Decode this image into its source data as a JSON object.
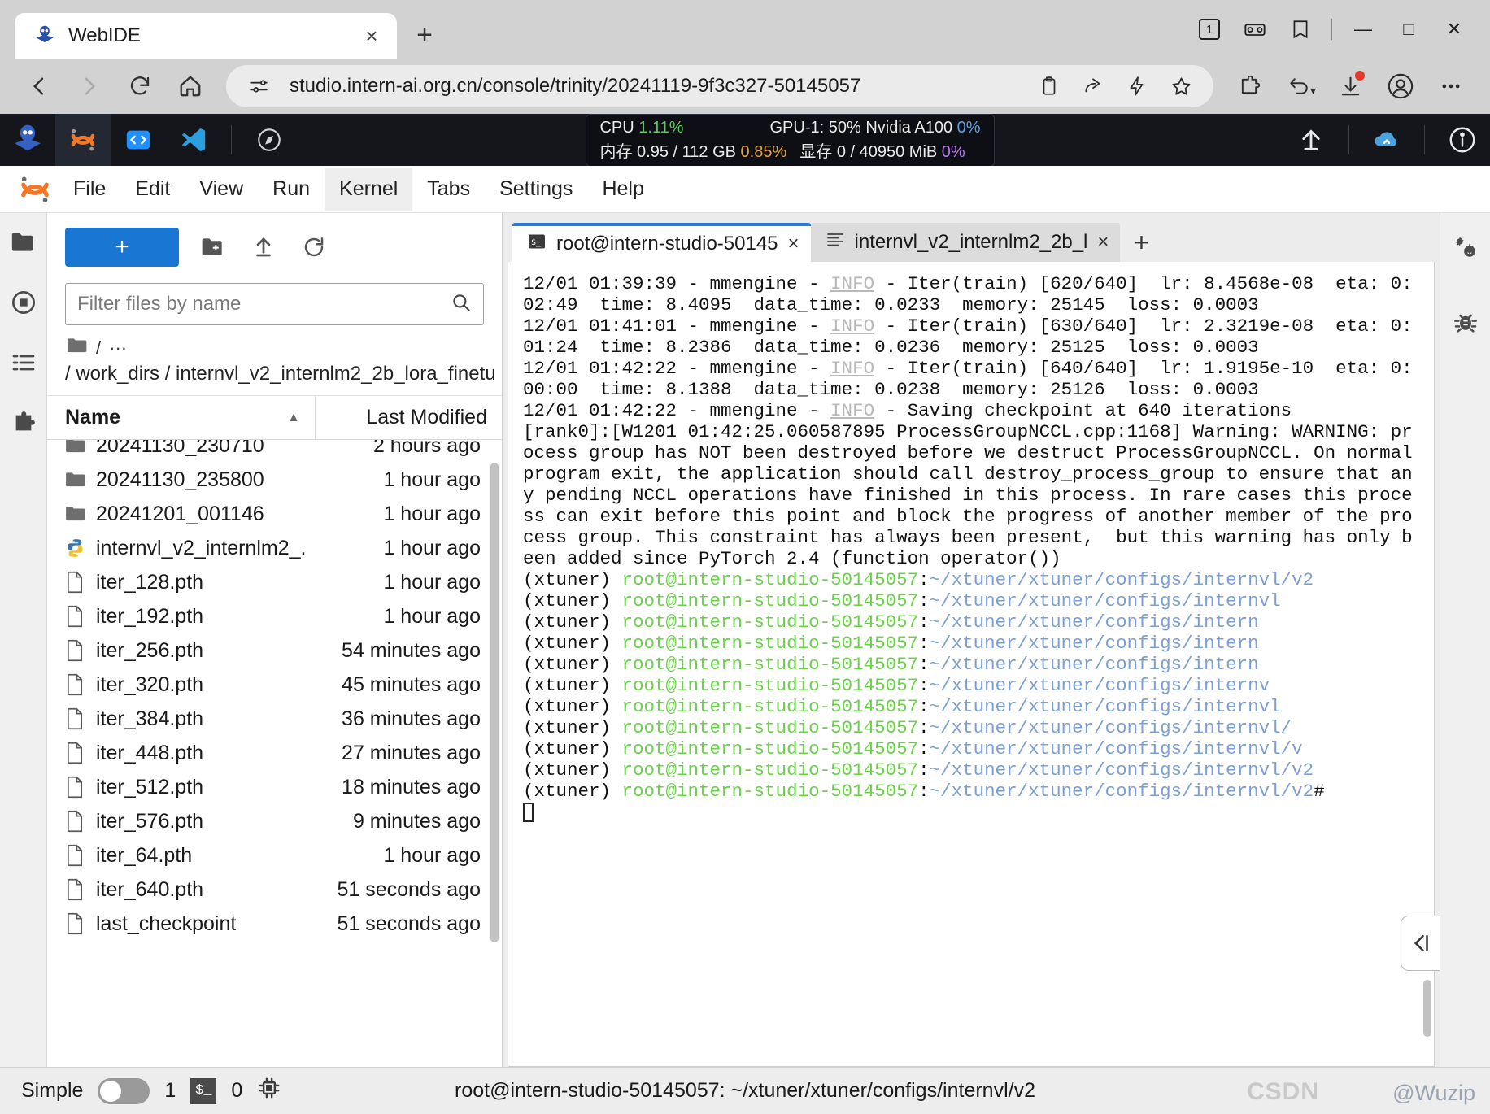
{
  "browser": {
    "tab": {
      "title": "WebIDE",
      "favicon": "intern-logo-icon",
      "close": "×"
    },
    "newtab_label": "+",
    "window_controls": {
      "count": "1",
      "minimize": "—",
      "maximize": "□",
      "close": "✕"
    },
    "nav": {
      "back": "‹",
      "forward": "›",
      "reload": "↻",
      "home": "⌂"
    },
    "omnibox": {
      "url": "studio.intern-ai.org.cn/console/trinity/20241119-9f3c327-50145057",
      "site_icon": "site-settings-icon"
    }
  },
  "topbar": {
    "stats": {
      "cpu_label": "CPU",
      "cpu_value": "1.11%",
      "gpu_label": "GPU-1: 50% Nvidia A100",
      "gpu_value": "0%",
      "mem_label": "内存",
      "mem_value": "0.95 / 112 GB",
      "mem_pct": "0.85%",
      "vram_label": "显存",
      "vram_value": "0 / 40950 MiB",
      "vram_pct": "0%"
    }
  },
  "menubar": {
    "items": [
      {
        "label": "File",
        "active": false
      },
      {
        "label": "Edit",
        "active": false
      },
      {
        "label": "View",
        "active": false
      },
      {
        "label": "Run",
        "active": false
      },
      {
        "label": "Kernel",
        "active": true
      },
      {
        "label": "Tabs",
        "active": false
      },
      {
        "label": "Settings",
        "active": false
      },
      {
        "label": "Help",
        "active": false
      }
    ]
  },
  "filebrowser": {
    "new_button": "+",
    "filter_placeholder": "Filter files by name",
    "breadcrumb_root": "/",
    "breadcrumb_ellipsis": "···",
    "path": "/ work_dirs / internvl_v2_internlm2_2b_lora_finetu",
    "columns": {
      "name": "Name",
      "modified": "Last Modified"
    },
    "rows": [
      {
        "icon": "folder-icon",
        "name": "20241130_230710",
        "modified": "2 hours ago"
      },
      {
        "icon": "folder-icon",
        "name": "20241130_235800",
        "modified": "1 hour ago"
      },
      {
        "icon": "folder-icon",
        "name": "20241201_001146",
        "modified": "1 hour ago"
      },
      {
        "icon": "python-file-icon",
        "name": "internvl_v2_internlm2_...",
        "modified": "1 hour ago"
      },
      {
        "icon": "file-icon",
        "name": "iter_128.pth",
        "modified": "1 hour ago"
      },
      {
        "icon": "file-icon",
        "name": "iter_192.pth",
        "modified": "1 hour ago"
      },
      {
        "icon": "file-icon",
        "name": "iter_256.pth",
        "modified": "54 minutes ago"
      },
      {
        "icon": "file-icon",
        "name": "iter_320.pth",
        "modified": "45 minutes ago"
      },
      {
        "icon": "file-icon",
        "name": "iter_384.pth",
        "modified": "36 minutes ago"
      },
      {
        "icon": "file-icon",
        "name": "iter_448.pth",
        "modified": "27 minutes ago"
      },
      {
        "icon": "file-icon",
        "name": "iter_512.pth",
        "modified": "18 minutes ago"
      },
      {
        "icon": "file-icon",
        "name": "iter_576.pth",
        "modified": "9 minutes ago"
      },
      {
        "icon": "file-icon",
        "name": "iter_64.pth",
        "modified": "1 hour ago"
      },
      {
        "icon": "file-icon",
        "name": "iter_640.pth",
        "modified": "51 seconds ago"
      },
      {
        "icon": "file-icon",
        "name": "last_checkpoint",
        "modified": "51 seconds ago"
      }
    ]
  },
  "tabs": {
    "items": [
      {
        "label": "root@intern-studio-50145",
        "icon": "terminal-icon",
        "active": true,
        "close": "×"
      },
      {
        "label": "internvl_v2_internlm2_2b_l",
        "icon": "log-file-icon",
        "active": false,
        "close": "×"
      }
    ],
    "add": "+"
  },
  "terminal": {
    "lines": [
      {
        "segments": [
          {
            "t": "12/01 01:39:39 - mmengine - ",
            "c": ""
          },
          {
            "t": "INFO",
            "c": "info"
          },
          {
            "t": " - Iter(train) [620/640]  lr: 8.4568e-08  eta: 0:02:49  time: 8.4095  data_time: 0.0233  memory: 25145  loss: 0.0003",
            "c": ""
          }
        ]
      },
      {
        "segments": [
          {
            "t": "12/01 01:41:01 - mmengine - ",
            "c": ""
          },
          {
            "t": "INFO",
            "c": "info"
          },
          {
            "t": " - Iter(train) [630/640]  lr: 2.3219e-08  eta: 0:01:24  time: 8.2386  data_time: 0.0236  memory: 25125  loss: 0.0003",
            "c": ""
          }
        ]
      },
      {
        "segments": [
          {
            "t": "12/01 01:42:22 - mmengine - ",
            "c": ""
          },
          {
            "t": "INFO",
            "c": "info"
          },
          {
            "t": " - Iter(train) [640/640]  lr: 1.9195e-10  eta: 0:00:00  time: 8.1388  data_time: 0.0238  memory: 25126  loss: 0.0003",
            "c": ""
          }
        ]
      },
      {
        "segments": [
          {
            "t": "12/01 01:42:22 - mmengine - ",
            "c": ""
          },
          {
            "t": "INFO",
            "c": "info"
          },
          {
            "t": " - Saving checkpoint at 640 iterations",
            "c": ""
          }
        ]
      },
      {
        "segments": [
          {
            "t": "[rank0]:[W1201 01:42:25.060587895 ProcessGroupNCCL.cpp:1168] Warning: WARNING: process group has NOT been destroyed before we destruct ProcessGroupNCCL. On normal program exit, the application should call destroy_process_group to ensure that any pending NCCL operations have finished in this process. In rare cases this process can exit before this point and block the progress of another member of the process group. This constraint has always been present,  but this warning has only been added since PyTorch 2.4 (function operator())",
            "c": ""
          }
        ]
      }
    ],
    "prompts": [
      {
        "env": "(xtuner) ",
        "user": "root@intern-studio-50145057",
        "sep": ":",
        "path": "~/xtuner/xtuner/configs/internvl/v2",
        "tail": ""
      },
      {
        "env": "(xtuner) ",
        "user": "root@intern-studio-50145057",
        "sep": ":",
        "path": "~/xtuner/xtuner/configs/internvl",
        "tail": ""
      },
      {
        "env": "(xtuner) ",
        "user": "root@intern-studio-50145057",
        "sep": ":",
        "path": "~/xtuner/xtuner/configs/intern",
        "tail": ""
      },
      {
        "env": "(xtuner) ",
        "user": "root@intern-studio-50145057",
        "sep": ":",
        "path": "~/xtuner/xtuner/configs/intern",
        "tail": ""
      },
      {
        "env": "(xtuner) ",
        "user": "root@intern-studio-50145057",
        "sep": ":",
        "path": "~/xtuner/xtuner/configs/intern",
        "tail": ""
      },
      {
        "env": "(xtuner) ",
        "user": "root@intern-studio-50145057",
        "sep": ":",
        "path": "~/xtuner/xtuner/configs/internv",
        "tail": ""
      },
      {
        "env": "(xtuner) ",
        "user": "root@intern-studio-50145057",
        "sep": ":",
        "path": "~/xtuner/xtuner/configs/internvl",
        "tail": ""
      },
      {
        "env": "(xtuner) ",
        "user": "root@intern-studio-50145057",
        "sep": ":",
        "path": "~/xtuner/xtuner/configs/internvl/",
        "tail": ""
      },
      {
        "env": "(xtuner) ",
        "user": "root@intern-studio-50145057",
        "sep": ":",
        "path": "~/xtuner/xtuner/configs/internvl/v",
        "tail": ""
      },
      {
        "env": "(xtuner) ",
        "user": "root@intern-studio-50145057",
        "sep": ":",
        "path": "~/xtuner/xtuner/configs/internvl/v2",
        "tail": ""
      },
      {
        "env": "(xtuner) ",
        "user": "root@intern-studio-50145057",
        "sep": ":",
        "path": "~/xtuner/xtuner/configs/internvl/v2",
        "tail": "#"
      }
    ]
  },
  "statusbar": {
    "mode_label": "Simple",
    "kernel_count": "1",
    "terminal_badge": "$_",
    "terminal_count": "0",
    "session_title": "root@intern-studio-50145057: ~/xtuner/xtuner/configs/internvl/v2",
    "watermark_csdn": "CSDN",
    "watermark_user": "@Wuzip"
  },
  "colors": {
    "accent_blue": "#1976d2",
    "tab_accent": "#2979d6",
    "term_green": "#6bd14a",
    "term_blue": "#7b9fd4",
    "stat_green": "#5ac85a",
    "stat_orange": "#e8a33d",
    "stat_blue": "#5aa0e8",
    "stat_purple": "#b47ae8"
  }
}
